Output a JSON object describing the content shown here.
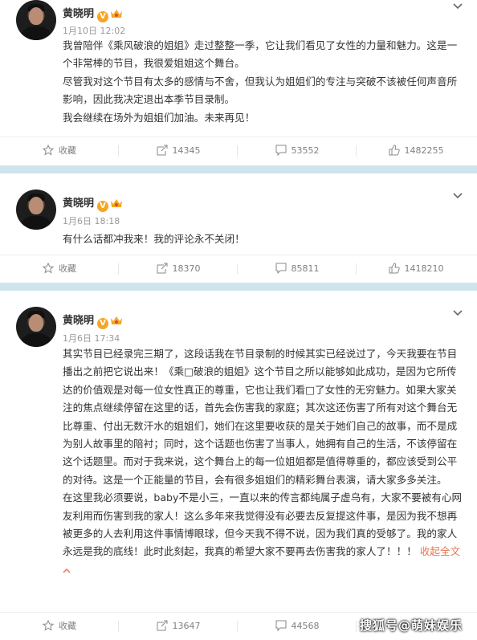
{
  "posts": [
    {
      "user": "黄晓明",
      "verified_badge": "V",
      "time": "1月10日 12:02",
      "paragraphs": [
        "我曾陪伴《乘风破浪的姐姐》走过整整一季，它让我们看见了女性的力量和魅力。这是一个非常棒的节目，我很爱姐姐这个舞台。",
        "尽管我对这个节目有太多的感情与不舍，但我认为姐姐们的专注与突破不该被任何声音所影响，因此我决定退出本季节目录制。",
        "我会继续在场外为姐姐们加油。未来再见！"
      ],
      "actions": {
        "favorite": "收藏",
        "repost": "14345",
        "comment": "53552",
        "like": "1482255"
      }
    },
    {
      "user": "黄晓明",
      "verified_badge": "V",
      "time": "1月6日 18:18",
      "paragraphs": [
        "有什么话都冲我来！我的评论永不关闭！"
      ],
      "actions": {
        "favorite": "收藏",
        "repost": "18370",
        "comment": "85811",
        "like": "1418210"
      }
    },
    {
      "user": "黄晓明",
      "verified_badge": "V",
      "time": "1月6日 17:34",
      "paragraphs": [
        "其实节目已经录完三期了，这段话我在节目录制的时候其实已经说过了，今天我要在节目播出之前把它说出来！《乘□破浪的姐姐》这个节目之所以能够如此成功，是因为它所传达的价值观是对每一位女性真正的尊重，它也让我们看□了女性的无穷魅力。如果大家关注的焦点继续停留在这里的话，首先会伤害我的家庭；其次这还伤害了所有对这个舞台无比尊重、付出无数汗水的姐姐们，她们在这里要收获的是关于她们自己的故事，而不是成为别人故事里的陪衬；同时，这个话题也伤害了当事人，她拥有自己的生活，不该停留在这个话题里。而对于我来说，这个舞台上的每一位姐姐都是值得尊重的，都应该受到公平的对待。这是一个正能量的节目，会有很多姐姐们的精彩舞台表演，请大家多多关注。",
        "在这里我必须要说，baby不是小三，一直以来的传言都纯属子虚乌有，大家不要被有心网友利用而伤害到我的家人！这么多年来我觉得没有必要去反复提这件事，是因为我不想再被更多的人去利用这件事情博眼球，但今天我不得不说，因为我们真的受够了。我的家人永远是我的底线！此时此刻起，我真的希望大家不要再去伤害我的家人了！！！"
      ],
      "collapse_label": "收起全文",
      "actions": {
        "favorite": "收藏",
        "repost": "13647",
        "comment": "44568",
        "like": ""
      }
    }
  ],
  "watermark": "搜狐号@萌妹娱乐",
  "colors": {
    "separator": "#cfe4ec",
    "badge": "#f5a623",
    "link": "#eb7350",
    "meta": "#999999"
  }
}
